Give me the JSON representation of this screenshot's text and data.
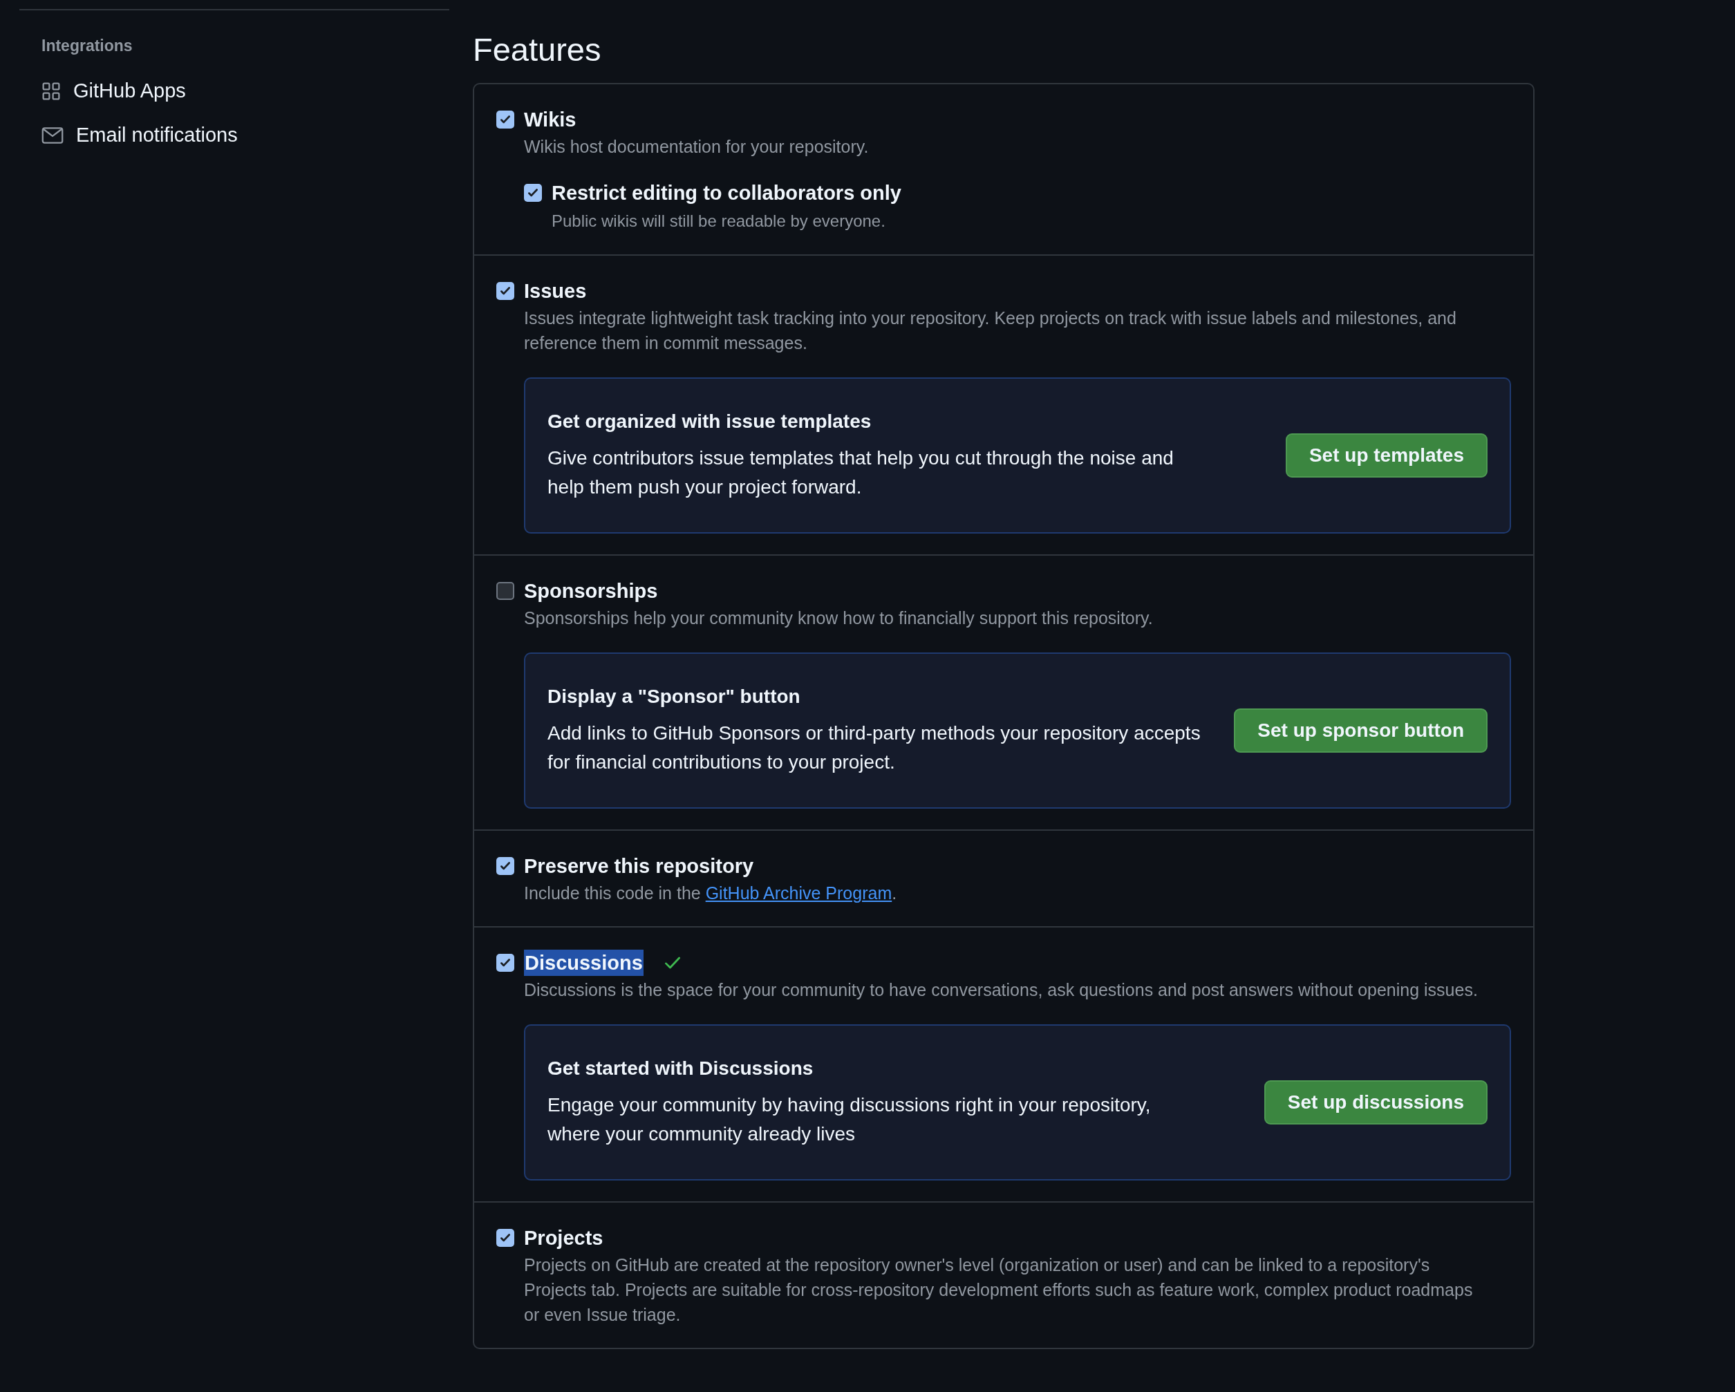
{
  "sidebar": {
    "section_title": "Integrations",
    "items": [
      {
        "kind": "apps",
        "label": "GitHub Apps"
      },
      {
        "kind": "mail",
        "label": "Email notifications"
      }
    ]
  },
  "page_title": "Features",
  "features": [
    {
      "title": "Wikis",
      "checked": true,
      "highlighted": false,
      "description": "Wikis host documentation for your repository.",
      "options": [
        {
          "title": "Restrict editing to collaborators only",
          "checked": true,
          "description": "Public wikis will still be readable by everyone."
        }
      ]
    },
    {
      "title": "Issues",
      "checked": true,
      "highlighted": false,
      "description": "Issues integrate lightweight task tracking into your repository. Keep projects on track with issue labels and milestones, and reference them in commit messages.",
      "callout": {
        "title": "Get organized with issue templates",
        "text": "Give contributors issue templates that help you cut through the noise and help them push your project forward.",
        "button": "Set up templates"
      }
    },
    {
      "title": "Sponsorships",
      "checked": false,
      "highlighted": false,
      "description": "Sponsorships help your community know how to financially support this repository.",
      "callout": {
        "title": "Display a \"Sponsor\" button",
        "text": "Add links to GitHub Sponsors or third-party methods your repository accepts for financial contributions to your project.",
        "button": "Set up sponsor button"
      }
    },
    {
      "title": "Preserve this repository",
      "checked": true,
      "highlighted": false,
      "description": "Include this code in the ",
      "link": "GitHub Archive Program",
      "description_end": "."
    },
    {
      "title": "Discussions",
      "checked": true,
      "highlighted": true,
      "saved": true,
      "description": "Discussions is the space for your community to have conversations, ask questions and post answers without opening issues.",
      "callout": {
        "title": "Get started with Discussions",
        "text": "Engage your community by having discussions right in your repository, where your community already lives",
        "button": "Set up discussions"
      }
    },
    {
      "title": "Projects",
      "checked": true,
      "highlighted": false,
      "description": "Projects on GitHub are created at the repository owner's level (organization or user) and can be linked to a repository's Projects tab. Projects are suitable for cross-repository development efforts such as feature work, complex product roadmaps or even Issue triage."
    }
  ]
}
